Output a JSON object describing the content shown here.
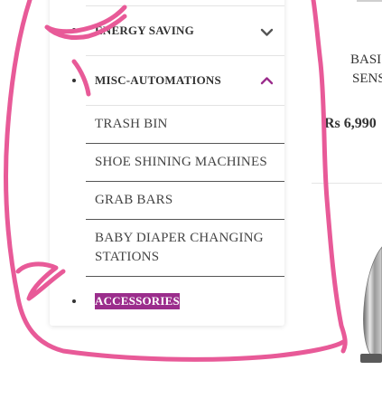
{
  "menu": {
    "categories": [
      {
        "label": "ENERGY SAVING",
        "expanded": false,
        "icon": "chevron-down-icon"
      },
      {
        "label": "MISC-AUTOMATIONS",
        "expanded": true,
        "icon": "chevron-up-icon"
      }
    ],
    "subitems": [
      {
        "label": "TRASH BIN"
      },
      {
        "label": "SHOE SHINING MACHINES"
      },
      {
        "label": "GRAB BARS"
      },
      {
        "label": "BABY DIAPER CHANGING",
        "label2": "STATIONS"
      }
    ],
    "accessories": {
      "label": "ACCESSORIES",
      "highlight_color": "#9b2d8c"
    }
  },
  "product": {
    "title_line1": "BASI",
    "title_line2": "SENS",
    "price": "Rs 6,990"
  },
  "colors": {
    "accent": "#9b2d8c",
    "scribble": "#e85a98"
  }
}
